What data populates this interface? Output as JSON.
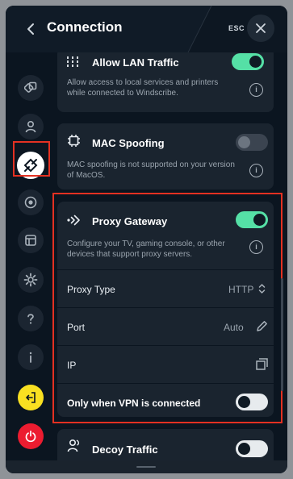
{
  "header": {
    "title": "Connection",
    "esc_label": "ESC"
  },
  "sidebar": {
    "items": [
      {
        "icon": "connection-sharing-icon"
      },
      {
        "icon": "account-icon"
      },
      {
        "icon": "connection-icon",
        "active": true
      },
      {
        "icon": "robert-icon"
      },
      {
        "icon": "advanced-icon"
      },
      {
        "icon": "general-settings-icon"
      },
      {
        "icon": "help-icon"
      },
      {
        "icon": "about-icon"
      },
      {
        "icon": "sign-out-icon"
      },
      {
        "icon": "quit-icon"
      }
    ]
  },
  "settings": {
    "allow_lan": {
      "title": "Allow LAN Traffic",
      "description": "Allow access to local services and printers while connected to Windscribe.",
      "enabled": true
    },
    "mac_spoofing": {
      "title": "MAC Spoofing",
      "description": "MAC spoofing is not supported on your version of MacOS.",
      "enabled": false
    },
    "proxy_gateway": {
      "title": "Proxy Gateway",
      "description": "Configure your TV, gaming console, or other devices that support proxy servers.",
      "enabled": true,
      "proxy_type_label": "Proxy Type",
      "proxy_type_value": "HTTP",
      "port_label": "Port",
      "port_value": "Auto",
      "ip_label": "IP",
      "vpn_only_label": "Only when VPN is connected",
      "vpn_only_enabled": false
    },
    "decoy_traffic": {
      "title": "Decoy Traffic",
      "enabled": false
    }
  },
  "colors": {
    "accent_green": "#55e0a6",
    "highlight_red": "#e33122",
    "background": "#0b1520",
    "card": "#1a242f"
  }
}
